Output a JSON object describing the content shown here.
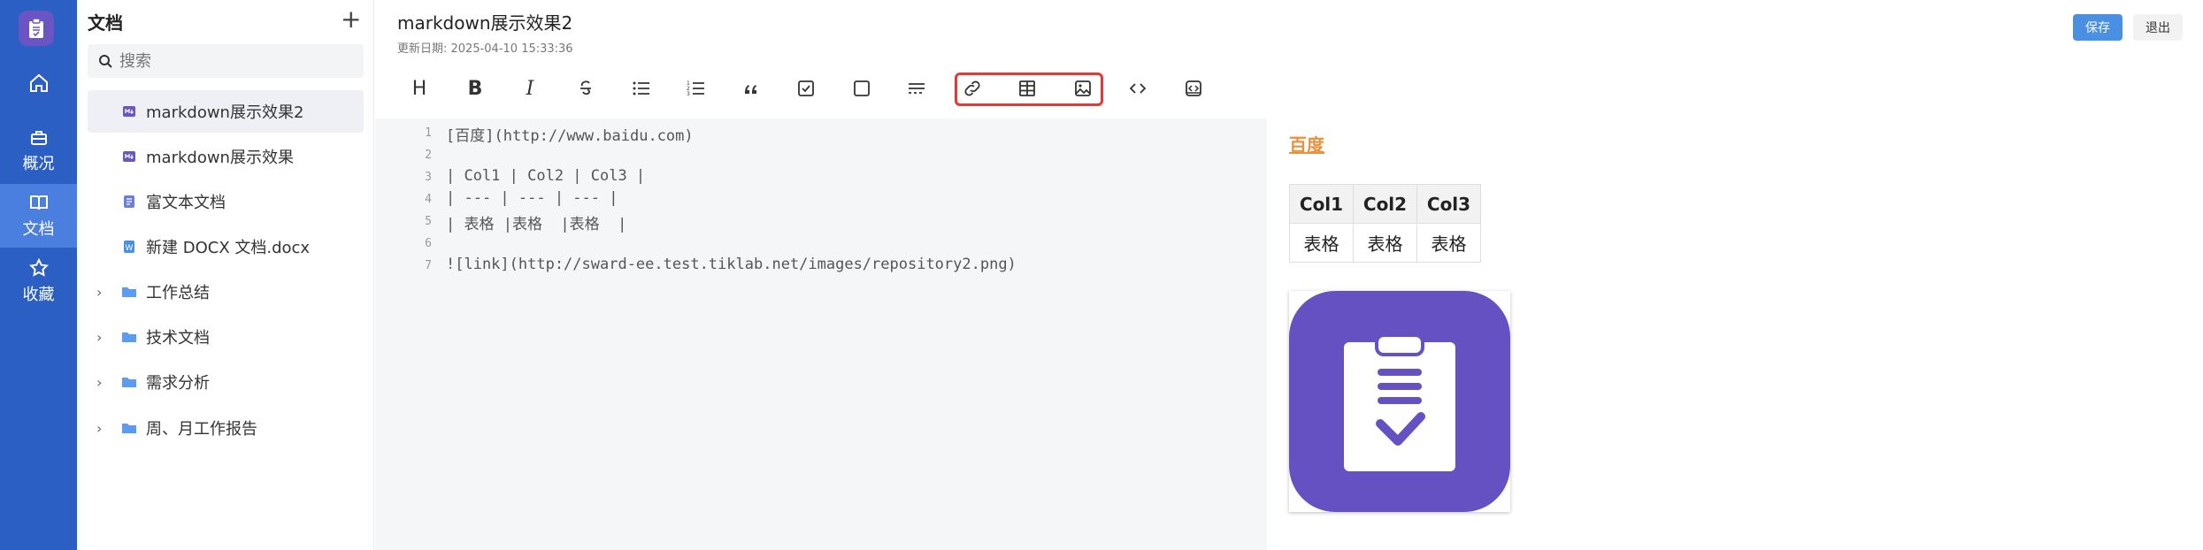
{
  "colors": {
    "rail": "#2b5fc4",
    "accent": "#6b54c4",
    "save": "#4a90e2",
    "link": "#e9913c",
    "highlight": "#e53935"
  },
  "rail": {
    "logo_icon": "clipboard-icon",
    "items": [
      {
        "name": "home",
        "label": "",
        "icon": "home-icon"
      },
      {
        "name": "overview",
        "label": "概况",
        "icon": "briefcase-icon"
      },
      {
        "name": "docs",
        "label": "文档",
        "icon": "book-icon"
      },
      {
        "name": "favorites",
        "label": "收藏",
        "icon": "star-icon"
      }
    ]
  },
  "sidebar": {
    "title": "文档",
    "add_icon": "plus-icon",
    "search_placeholder": "搜索",
    "items": [
      {
        "label": "markdown展示效果2",
        "icon": "markdown-icon",
        "selected": true
      },
      {
        "label": "markdown展示效果",
        "icon": "markdown-icon"
      },
      {
        "label": "富文本文档",
        "icon": "document-icon"
      },
      {
        "label": "新建 DOCX 文档.docx",
        "icon": "word-icon"
      },
      {
        "label": "工作总结",
        "icon": "folder-icon",
        "expandable": true
      },
      {
        "label": "技术文档",
        "icon": "folder-icon",
        "expandable": true
      },
      {
        "label": "需求分析",
        "icon": "folder-icon",
        "expandable": true
      },
      {
        "label": "周、月工作报告",
        "icon": "folder-icon",
        "expandable": true
      }
    ]
  },
  "header": {
    "title": "markdown展示效果2",
    "date": "更新日期: 2025-04-10 15:33:36",
    "save_label": "保存",
    "exit_label": "退出"
  },
  "toolbar": {
    "heading": "H",
    "bold": "B",
    "italic": "I",
    "buttons": [
      "heading-icon",
      "bold-icon",
      "italic-icon",
      "strikethrough-icon",
      "bullet-list-icon",
      "ordered-list-icon",
      "quote-icon",
      "task-checkbox-icon",
      "square-icon",
      "divider-icon",
      "link-icon",
      "table-icon",
      "image-icon",
      "code-icon",
      "code-block-icon"
    ]
  },
  "editor": {
    "lines": [
      {
        "n": "1",
        "text": "[百度](http://www.baidu.com)"
      },
      {
        "n": "2",
        "text": ""
      },
      {
        "n": "3",
        "text": "| Col1 | Col2 | Col3 |"
      },
      {
        "n": "4",
        "text": "| --- | --- | --- |"
      },
      {
        "n": "5",
        "text": "| 表格 |表格  |表格  |"
      },
      {
        "n": "6",
        "text": ""
      },
      {
        "n": "7",
        "text": "![link](http://sward-ee.test.tiklab.net/images/repository2.png)"
      }
    ]
  },
  "preview": {
    "link_text": "百度",
    "table": {
      "headers": [
        "Col1",
        "Col2",
        "Col3"
      ],
      "rows": [
        [
          "表格",
          "表格",
          "表格"
        ]
      ]
    },
    "image_alt": "link"
  }
}
